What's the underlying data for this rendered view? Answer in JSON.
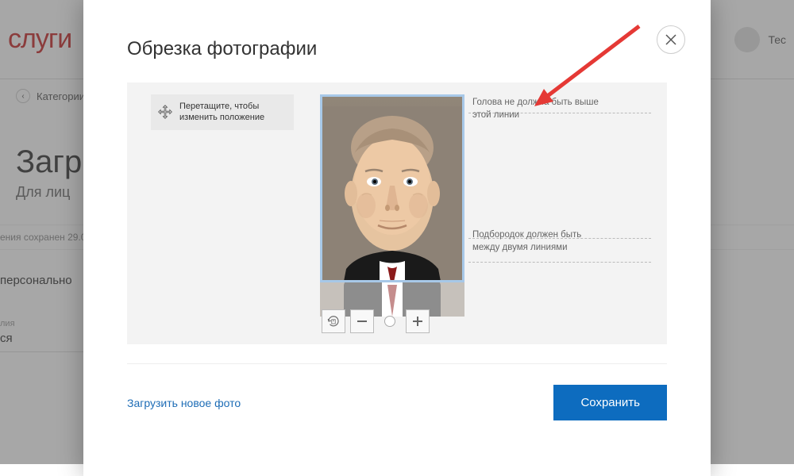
{
  "background": {
    "logo_fragment": "слуги",
    "user_label": "Тес",
    "breadcrumb": "Категории",
    "title_fragment": "Загр",
    "subtitle_fragment": "Для лиц",
    "saved_fragment": "ения сохранен 29.0",
    "section_fragment": "персонально",
    "field_label_fragment": "лия",
    "field_value_fragment": "ся"
  },
  "modal": {
    "title": "Обрезка фотографии",
    "drag_hint": "Перетащите, чтобы изменить положение",
    "annotation_top": "Голова не должна быть выше этой линии",
    "annotation_bottom": "Подбородок должен быть между двумя линиями",
    "upload_link": "Загрузить новое фото",
    "save_button": "Сохранить"
  }
}
